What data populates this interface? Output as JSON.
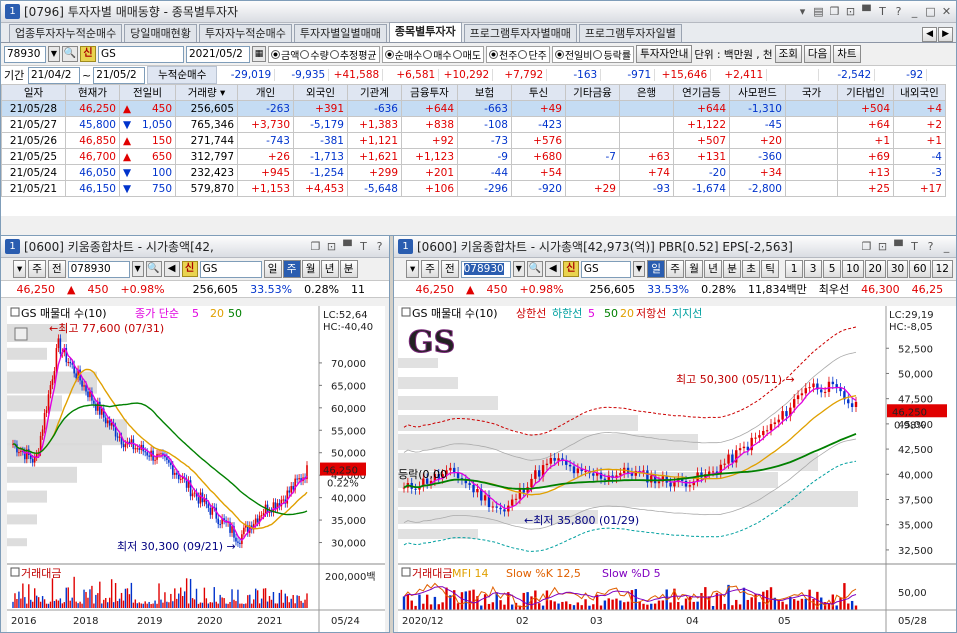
{
  "top_window": {
    "title": "[0796] 투자자별 매매동향 - 종목별투자자",
    "tabs": [
      "업종투자자누적순매수",
      "당일매매현황",
      "투자자누적순매수",
      "투자자별일별매매",
      "종목별투자자",
      "프로그램투자자별매매",
      "프로그램투자자일별"
    ],
    "active_tab": "종목별투자자",
    "code": "78930",
    "stock_name": "GS",
    "date": "2021/05/2",
    "radios1": [
      "금액",
      "수량",
      "추정평균"
    ],
    "radios2": [
      "순매수",
      "매수",
      "매도"
    ],
    "radios3": [
      "천주",
      "단주"
    ],
    "radios4": [
      "전일비",
      "등락률"
    ],
    "btn_investor": "투자자안내",
    "unit_text": "단위 : 백만원 , 천",
    "btn_search": "조회",
    "btn_next": "다음",
    "btn_chart": "차트",
    "period_label": "기간",
    "period_from": "21/04/2",
    "period_to": "21/05/2",
    "cum_label": "누적순매수",
    "cum_values": [
      "-29,019",
      "-9,935",
      "+41,588",
      "+6,581",
      "+10,292",
      "+7,792",
      "-163",
      "-971",
      "+15,646",
      "+2,411",
      "",
      "-2,542",
      "-92"
    ],
    "headers": [
      "일자",
      "현재가",
      "전일비",
      "거래량",
      "개인",
      "외국인",
      "기관계",
      "금융투자",
      "보험",
      "투신",
      "기타금융",
      "은행",
      "연기금등",
      "사모펀드",
      "국가",
      "기타법인",
      "내외국인"
    ],
    "rows": [
      [
        "21/05/28",
        "46,250",
        "▲",
        "450",
        "256,605",
        "-263",
        "+391",
        "-636",
        "+644",
        "-663",
        "+49",
        "",
        "",
        "+644",
        "-1,310",
        "",
        "+504",
        "+4"
      ],
      [
        "21/05/27",
        "45,800",
        "▼",
        "1,050",
        "765,346",
        "+3,730",
        "-5,179",
        "+1,383",
        "+838",
        "-108",
        "-423",
        "",
        "",
        "+1,122",
        "-45",
        "",
        "+64",
        "+2"
      ],
      [
        "21/05/26",
        "46,850",
        "▲",
        "150",
        "271,744",
        "-743",
        "-381",
        "+1,121",
        "+92",
        "-73",
        "+576",
        "",
        "",
        "+507",
        "+20",
        "",
        "+1",
        "+1"
      ],
      [
        "21/05/25",
        "46,700",
        "▲",
        "650",
        "312,797",
        "+26",
        "-1,713",
        "+1,621",
        "+1,123",
        "-9",
        "+680",
        "-7",
        "+63",
        "+131",
        "-360",
        "",
        "+69",
        "-4"
      ],
      [
        "21/05/24",
        "46,050",
        "▼",
        "100",
        "232,423",
        "+945",
        "-1,254",
        "+299",
        "+201",
        "-44",
        "+54",
        "",
        "+74",
        "-20",
        "+34",
        "",
        "+13",
        "-3"
      ],
      [
        "21/05/21",
        "46,150",
        "▼",
        "750",
        "579,870",
        "+1,153",
        "+4,453",
        "-5,648",
        "+106",
        "-296",
        "-920",
        "+29",
        "-93",
        "-1,674",
        "-2,800",
        "",
        "+25",
        "+17"
      ]
    ]
  },
  "left_chart": {
    "title": "[0600] 키움종합차트 - 시가총액[42,",
    "code": "078930",
    "name": "GS",
    "periods": [
      "일",
      "주",
      "월",
      "년",
      "분"
    ],
    "active_period": "주",
    "price": "46,250",
    "change": "450",
    "pct": "+0.98%",
    "volume": "256,605",
    "ratio1": "33.53%",
    "ratio2": "0.28%",
    "extra": "11",
    "legend_name": "GS 매물대 수(10)",
    "legend_ma": "종가 단순",
    "legend_ma_vals": [
      "5",
      "20",
      "50"
    ],
    "high_note": "최고 77,600 (07/31)",
    "low_note": "최저 30,300 (09/21)",
    "lc": "LC:52,64",
    "hc": "HC:-40,40",
    "price_tag": "46,250",
    "pct_tag": "0.22%",
    "y_ticks": [
      "70,000",
      "65,000",
      "60,000",
      "55,000",
      "50,000",
      "45,000",
      "40,000",
      "35,000",
      "30,000"
    ],
    "x_ticks": [
      "2016",
      "2018",
      "2019",
      "2020",
      "2021",
      "05/24"
    ],
    "sub_legend": "거래대금",
    "sub_tick": "200,000백"
  },
  "right_chart": {
    "title": "[0600] 키움종합차트 - 시가총액[42,973(억)] PBR[0.52] EPS[-2,563]",
    "code": "078930",
    "name": "GS",
    "periods": [
      "일",
      "주",
      "월",
      "년",
      "분",
      "초",
      "틱"
    ],
    "active_period": "일",
    "minutes": [
      "1",
      "3",
      "5",
      "10",
      "20",
      "30",
      "60",
      "12"
    ],
    "price": "46,250",
    "change": "450",
    "pct": "+0.98%",
    "volume": "256,605",
    "ratio1": "33.53%",
    "ratio2": "0.28%",
    "amount": "11,834백만",
    "best": "최우선",
    "ask": "46,300",
    "bid": "46,25",
    "watermark": "GS",
    "legend_name": "GS 매물대 수(10)",
    "legend_items": [
      "상한선",
      "하한선",
      "5",
      "50",
      "20",
      "저항선",
      "지지선"
    ],
    "high_note": "최고 50,300 (05/11)",
    "low_note": "최저 35,800 (01/29)",
    "left_note": "등락(0,00",
    "lc": "LC:29,19",
    "hc": "HC:-8,05",
    "price_tag": "46,250",
    "pct_tag": "0.98%",
    "y_ticks": [
      "52,500",
      "50,000",
      "47,500",
      "45,000",
      "42,500",
      "40,000",
      "37,500",
      "35,000",
      "32,500"
    ],
    "x_ticks": [
      "2020/12",
      "02",
      "03",
      "04",
      "05",
      "05/28"
    ],
    "sub_legend": [
      "거래대금",
      "MFI 14",
      "Slow %K 12,5",
      "Slow %D 5"
    ],
    "sub_tick": "50,00"
  },
  "colors": {
    "up": "#e00000",
    "down": "#0033cc",
    "ma5": "#e000e0",
    "ma20": "#e0a000",
    "ma50": "#008000"
  }
}
